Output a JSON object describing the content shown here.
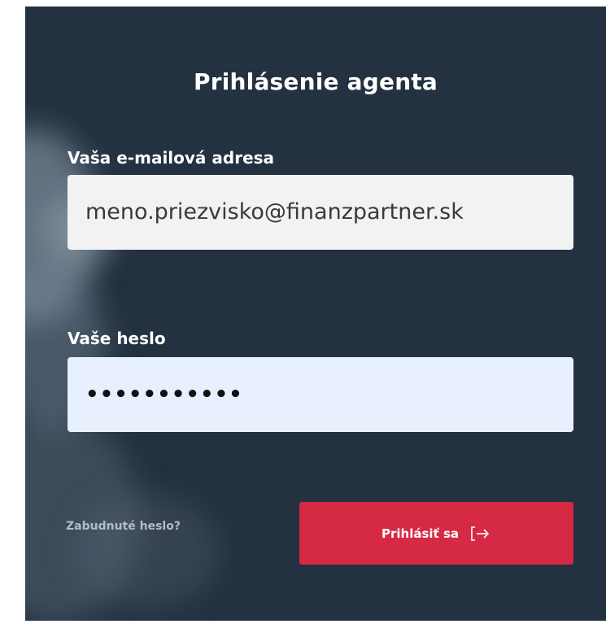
{
  "login": {
    "title": "Prihlásenie agenta",
    "email_label": "Vaša e-mailová adresa",
    "email_value": "meno.priezvisko@finanzpartner.sk",
    "password_label": "Vaše heslo",
    "password_mask": "•••••••••••",
    "forgot_link": "Zabudnuté heslo?",
    "submit_label": "Prihlásiť sa",
    "submit_icon": "login-arrow-icon"
  },
  "colors": {
    "panel_bg": "#233140",
    "button_bg": "#d62943",
    "email_field_bg": "#f2f2f2",
    "password_field_bg": "#e8f0fd",
    "link_color": "#b5bcc4"
  }
}
